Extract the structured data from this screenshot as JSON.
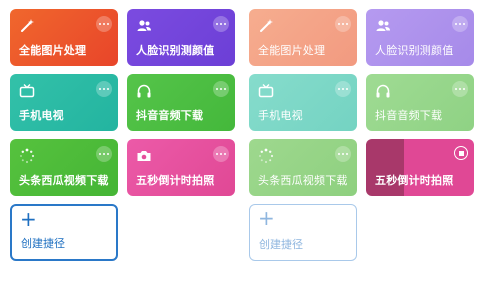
{
  "left_panel": {
    "tiles": [
      {
        "label": "全能图片处理",
        "icon": "magic-wand-icon",
        "color_from": "#f0672d",
        "color_to": "#e8452a"
      },
      {
        "label": "人脸识别测颜值",
        "icon": "people-icon",
        "color_from": "#7b4be0",
        "color_to": "#6c3fd6"
      },
      {
        "label": "手机电视",
        "icon": "tv-icon",
        "color_from": "#33c1a9",
        "color_to": "#23b4a0"
      },
      {
        "label": "抖音音频下载",
        "icon": "headphones-icon",
        "color_from": "#55c44a",
        "color_to": "#44b83b"
      },
      {
        "label": "头条西瓜视频下载",
        "icon": "spinner-icon",
        "color_from": "#56c23e",
        "color_to": "#45b535"
      },
      {
        "label": "五秒倒计时拍照",
        "icon": "camera-icon",
        "color_from": "#ec5aa8",
        "color_to": "#e04895"
      }
    ],
    "create": {
      "plus": "+",
      "label": "创建捷径"
    }
  },
  "right_panel": {
    "tiles": [
      {
        "label": "全能图片处理",
        "icon": "magic-wand-icon",
        "color_from": "#f6ad8f",
        "color_to": "#f29a80"
      },
      {
        "label": "人脸识别测颜值",
        "icon": "people-icon",
        "color_from": "#b59af0",
        "color_to": "#a68ae9"
      },
      {
        "label": "手机电视",
        "icon": "tv-icon",
        "color_from": "#86dccc",
        "color_to": "#74d3c2"
      },
      {
        "label": "抖音音频下载",
        "icon": "headphones-icon",
        "color_from": "#9fdb93",
        "color_to": "#8fd284"
      },
      {
        "label": "头条西瓜视频下载",
        "icon": "spinner-icon",
        "color_from": "#9ed88e",
        "color_to": "#8ed07f"
      },
      {
        "label": "五秒倒计时拍照",
        "icon": "stop-button",
        "color_from": "#a8386a",
        "color_to": "#e04895",
        "progress": 0.35
      }
    ],
    "create": {
      "plus": "+",
      "label": "创建捷径"
    }
  }
}
